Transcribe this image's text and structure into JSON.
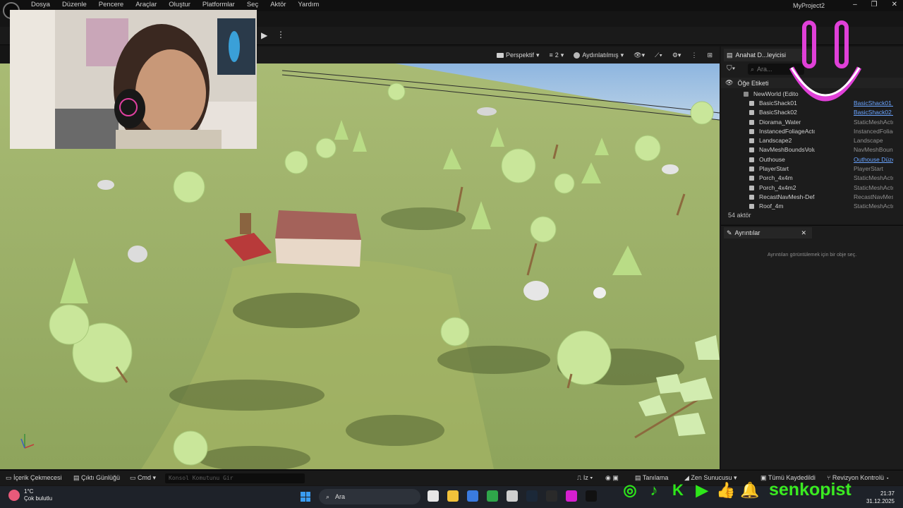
{
  "menu": {
    "items": [
      "Dosya",
      "Düzenle",
      "Pencere",
      "Araçlar",
      "Oluştur",
      "Platformlar",
      "Seç",
      "Aktör",
      "Yardım"
    ],
    "project": "MyProject2"
  },
  "viewport": {
    "perspective_label": "Perspektif",
    "fov_label": "2",
    "lighting_label": "Aydınlatılmış"
  },
  "outliner": {
    "tab_title": "Anahat D...leyicisi",
    "search_placeholder": "Ara...",
    "column_label": "Öğe Etiketi",
    "world_row": "NewWorld (Edito",
    "rows": [
      {
        "name": "BasicShack01",
        "type": "BasicShack01 I",
        "link": true
      },
      {
        "name": "BasicShack02",
        "type": "BasicShack02 I",
        "link": true
      },
      {
        "name": "Diorama_Water",
        "type": "StaticMeshActo",
        "link": false
      },
      {
        "name": "InstancedFoliageActor0",
        "type": "InstancedFoliag",
        "link": false
      },
      {
        "name": "Landscape2",
        "type": "Landscape",
        "link": false
      },
      {
        "name": "NavMeshBoundsVolume",
        "type": "NavMeshBound",
        "link": false
      },
      {
        "name": "Outhouse",
        "type": "Outhouse Düze",
        "link": true
      },
      {
        "name": "PlayerStart",
        "type": "PlayerStart",
        "link": false
      },
      {
        "name": "Porch_4x4m",
        "type": "StaticMeshActo",
        "link": false
      },
      {
        "name": "Porch_4x4m2",
        "type": "StaticMeshActo",
        "link": false
      },
      {
        "name": "RecastNavMesh-Default",
        "type": "RecastNavMesh",
        "link": false
      },
      {
        "name": "Roof_4m",
        "type": "StaticMeshActo",
        "link": false
      }
    ],
    "actor_count": "54 aktör"
  },
  "details": {
    "tab_title": "Ayrıntılar",
    "empty_text": "Ayrıntıları görüntülemek için bir obje seç."
  },
  "statusbar": {
    "content_drawer": "İçerik Çekmecesi",
    "output_log": "Çıktı Günlüğü",
    "cmd": "Cmd",
    "console_placeholder": "Konsol Komutunu Gir",
    "trace": "Iz",
    "derived_data": "Tanılama",
    "zen": "Zen Sunucusu",
    "save_all": "Tümü Kaydedildi",
    "revision": "Revizyon Kontrolü"
  },
  "taskbar": {
    "temperature": "1°C",
    "weather": "Çok bulutlu",
    "search": "Ara",
    "time": "21:37",
    "date": "31.12.2025"
  },
  "overlay": {
    "handle": "senkopist",
    "accent_color": "#2ee61a",
    "smiley_color": "#e040d8"
  }
}
